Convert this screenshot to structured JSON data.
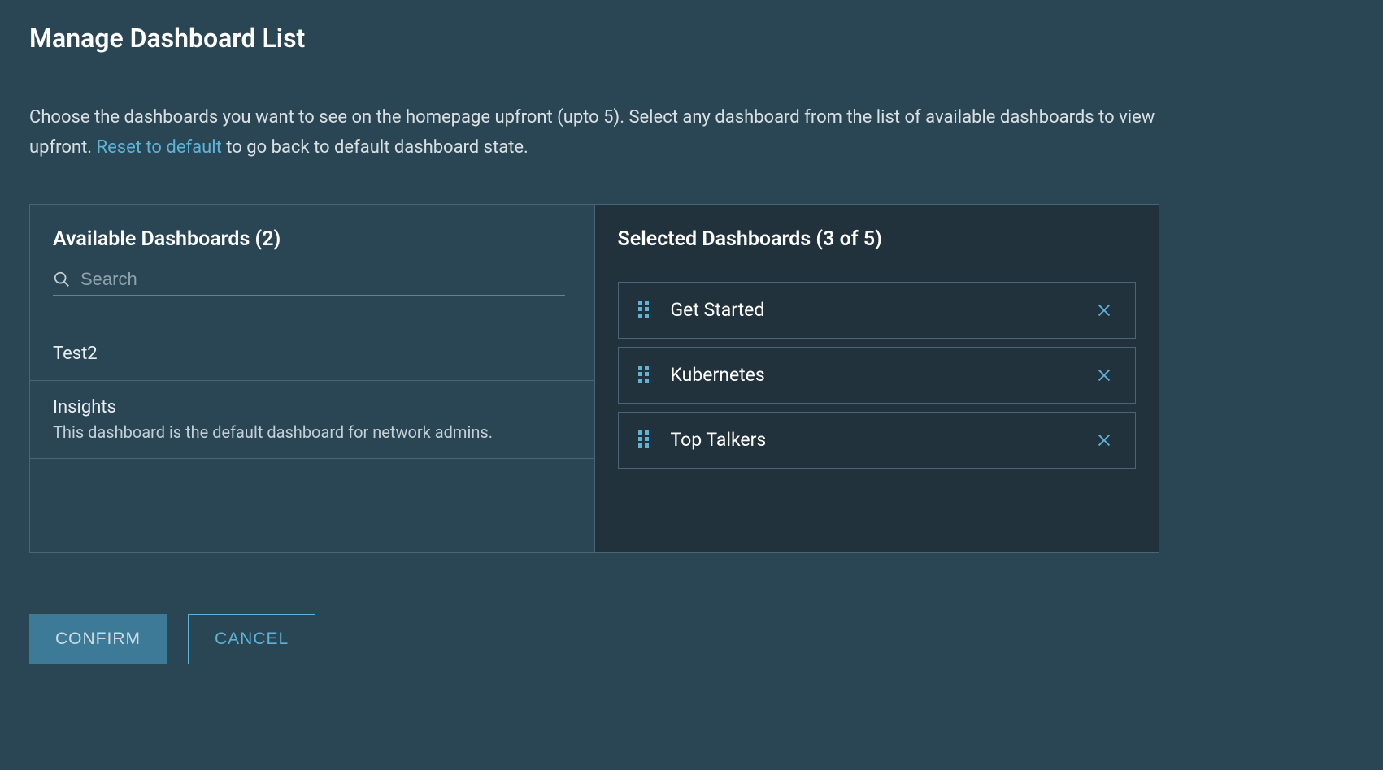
{
  "title": "Manage Dashboard List",
  "description": {
    "part1": "Choose the dashboards you want to see on the homepage upfront (upto 5). Select any dashboard from the list of available dashboards to view upfront. ",
    "reset_link": "Reset to default",
    "part2": " to go back to default dashboard state."
  },
  "available": {
    "title": "Available Dashboards (2)",
    "search_placeholder": "Search",
    "items": [
      {
        "title": "Test2",
        "desc": ""
      },
      {
        "title": "Insights",
        "desc": "This dashboard is the default dashboard for network admins."
      }
    ]
  },
  "selected": {
    "title": "Selected Dashboards (3 of 5)",
    "items": [
      {
        "label": "Get Started"
      },
      {
        "label": "Kubernetes"
      },
      {
        "label": "Top Talkers"
      }
    ]
  },
  "buttons": {
    "confirm": "CONFIRM",
    "cancel": "CANCEL"
  }
}
